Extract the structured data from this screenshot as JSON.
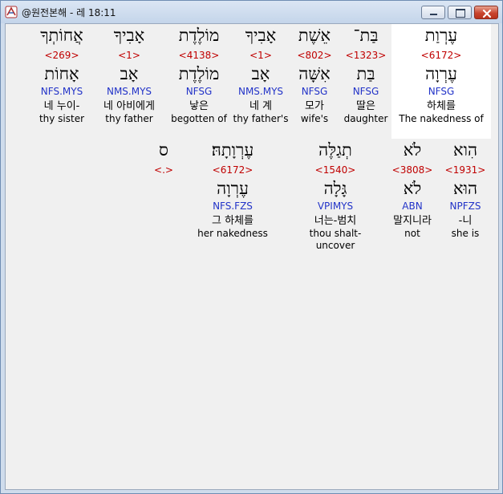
{
  "window": {
    "title": "@원전본해 - 레 18:11",
    "icon": "app-logo-icon",
    "controls": [
      "minimize-icon",
      "maximize-icon",
      "close-icon"
    ]
  },
  "rows": [
    {
      "words": [
        {
          "heb": "עֶרְוַת",
          "strong": "<6172>",
          "lemma": "עֶרְוָה",
          "morph": "NFSG",
          "kor": "하체를",
          "eng": "The nakedness of",
          "selected": true
        },
        {
          "heb": "בַּת־",
          "strong": "<1323>",
          "lemma": "בַּת",
          "morph": "NFSG",
          "kor": "딸은",
          "eng": "daughter"
        },
        {
          "heb": "אֵשֶׁת",
          "strong": "<802>",
          "lemma": "אִשָּׁה",
          "morph": "NFSG",
          "kor": "모가",
          "eng": "wife's"
        },
        {
          "heb": "אָבִיךָ",
          "strong": "<1>",
          "lemma": "אָב",
          "morph": "NMS.MYS",
          "kor": "네 계",
          "eng": "thy father's"
        },
        {
          "heb": "מוֹלֶדֶת",
          "strong": "<4138>",
          "lemma": "מוֹלֶדֶת",
          "morph": "NFSG",
          "kor": "낳은",
          "eng": "begotten of"
        },
        {
          "heb": "אָבִיךָ",
          "strong": "<1>",
          "lemma": "אָב",
          "morph": "NMS.MYS",
          "kor": "네 아비에게",
          "eng": "thy father"
        },
        {
          "heb": "אֲחוֹתְךָ",
          "strong": "<269>",
          "lemma": "אָחוֹת",
          "morph": "NFS.MYS",
          "kor": "네 누이-",
          "eng": "thy sister"
        }
      ]
    },
    {
      "words": [
        {
          "heb": "הִוא",
          "strong": "<1931>",
          "lemma": "הוּא",
          "morph": "NPFZS",
          "kor": "-니",
          "eng": "she is"
        },
        {
          "heb": "לֹא",
          "strong": "<3808>",
          "lemma": "לֹא",
          "morph": "ABN",
          "kor": "말지니라",
          "eng": "not"
        },
        {
          "heb": "תְגַלֶּה",
          "strong": "<1540>",
          "lemma": "גָּלָה",
          "morph": "VPIMYS",
          "kor": "너는-범치",
          "eng": "thou shalt-uncover"
        },
        {
          "heb": "עֶרְוָתָהּ׃",
          "strong": "<6172>",
          "lemma": "עֶרְוָה",
          "morph": "NFS.FZS",
          "kor": "그 하체를",
          "eng": "her nakedness"
        },
        {
          "heb": "ס",
          "strong": "<.>"
        }
      ]
    }
  ]
}
